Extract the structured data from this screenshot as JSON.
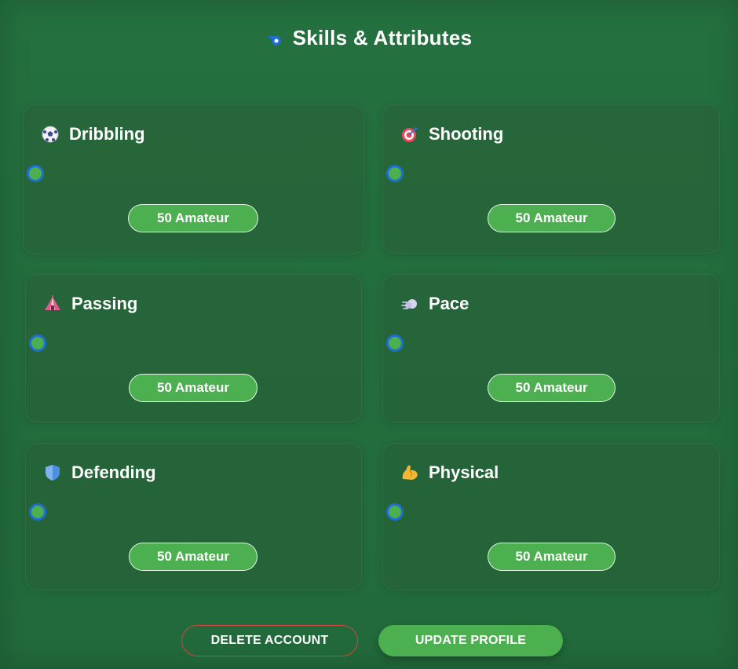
{
  "header": {
    "icon": "whistle-icon",
    "title": "Skills & Attributes"
  },
  "skills": [
    {
      "label": "Dribbling",
      "icon": "soccer-ball-icon",
      "level_text": "50 Amateur",
      "value": 50
    },
    {
      "label": "Shooting",
      "icon": "target-icon",
      "level_text": "50 Amateur",
      "value": 50
    },
    {
      "label": "Passing",
      "icon": "circus-tent-icon",
      "level_text": "50 Amateur",
      "value": 50
    },
    {
      "label": "Pace",
      "icon": "dash-icon",
      "level_text": "50 Amateur",
      "value": 50
    },
    {
      "label": "Defending",
      "icon": "shield-icon",
      "level_text": "50 Amateur",
      "value": 50
    },
    {
      "label": "Physical",
      "icon": "flexed-biceps-icon",
      "level_text": "50 Amateur",
      "value": 50
    }
  ],
  "actions": {
    "delete_label": "DELETE ACCOUNT",
    "update_label": "UPDATE PROFILE"
  },
  "colors": {
    "background": "#236b3c",
    "accent": "#4caf50",
    "slider_border": "#1e6fd0",
    "danger": "#d0473b"
  }
}
